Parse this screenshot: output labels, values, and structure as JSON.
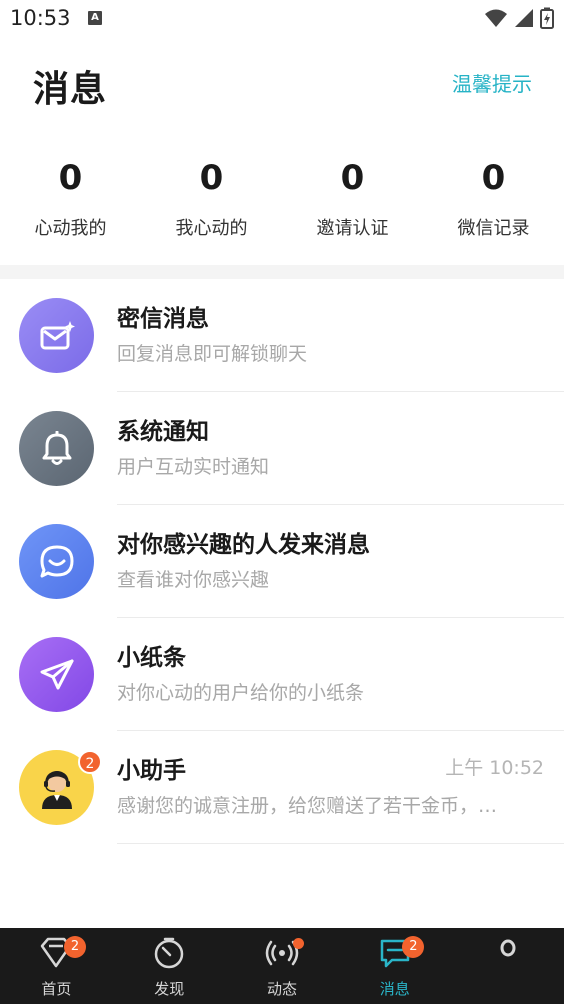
{
  "status_bar": {
    "time": "10:53",
    "notif_icon": "A"
  },
  "header": {
    "title": "消息",
    "tips_label": "温馨提示"
  },
  "stats": [
    {
      "value": "0",
      "label": "心动我的"
    },
    {
      "value": "0",
      "label": "我心动的"
    },
    {
      "value": "0",
      "label": "邀请认证"
    },
    {
      "value": "0",
      "label": "微信记录"
    }
  ],
  "messages": [
    {
      "title": "密信消息",
      "subtitle": "回复消息即可解锁聊天",
      "icon": "mail-icon",
      "color": "#8b7cf0"
    },
    {
      "title": "系统通知",
      "subtitle": "用户互动实时通知",
      "icon": "bell-icon",
      "color": "#6b7784"
    },
    {
      "title": "对你感兴趣的人发来消息",
      "subtitle": "查看谁对你感兴趣",
      "icon": "chat-icon",
      "color": "#5f86f2"
    },
    {
      "title": "小纸条",
      "subtitle": "对你心动的用户给你的小纸条",
      "icon": "paper-plane-icon",
      "color": "#9a5ff0"
    },
    {
      "title": "小助手",
      "subtitle": "感谢您的诚意注册，给您赠送了若干金币，…",
      "icon": "assistant-avatar",
      "color": "#f9d44a",
      "time": "上午 10:52",
      "badge": "2"
    }
  ],
  "bottom_nav": [
    {
      "label": "首页",
      "icon": "heart-diamond-icon",
      "badge": "2"
    },
    {
      "label": "发现",
      "icon": "compass-icon"
    },
    {
      "label": "动态",
      "icon": "broadcast-icon",
      "dot": true
    },
    {
      "label": "消息",
      "icon": "message-icon",
      "badge": "2",
      "active": true
    }
  ],
  "colors": {
    "accent": "#26b3c6",
    "badge": "#f2632e",
    "nav_bg": "#1a1a1a"
  }
}
